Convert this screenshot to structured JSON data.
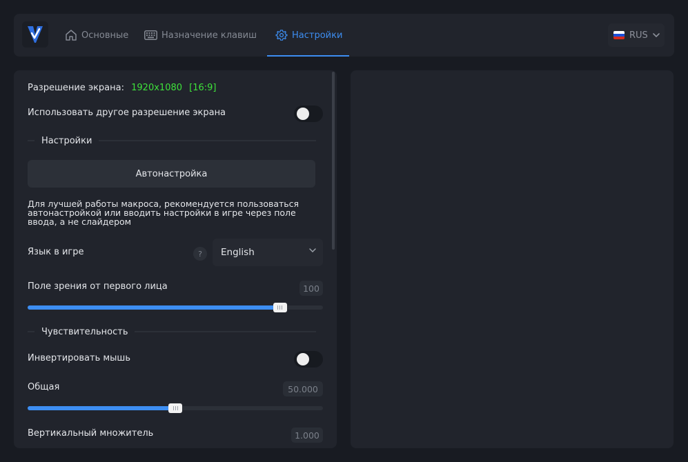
{
  "nav": {
    "tabs": [
      {
        "label": "Основные",
        "icon": "home-icon",
        "active": false
      },
      {
        "label": "Назначение клавиш",
        "icon": "keyboard-icon",
        "active": false
      },
      {
        "label": "Настройки",
        "icon": "gear-icon",
        "active": true
      }
    ],
    "language": {
      "code": "RUS",
      "flag_colors": [
        "#ffffff",
        "#1c4fd8",
        "#d52b1e"
      ]
    }
  },
  "settings": {
    "resolution": {
      "label": "Разрешение экрана:",
      "value": "1920x1080",
      "aspect": "[16:9]"
    },
    "custom_resolution": {
      "label": "Использовать другое разрешение экрана",
      "enabled": false
    },
    "section_settings": "Настройки",
    "autotune_button": "Автонастройка",
    "note": "Для лучшей работы макроса, рекомендуется пользоваться автонастройкой или вводить настройки в игре через поле ввода, а не слайдером",
    "game_language": {
      "label": "Язык в игре",
      "help": "?",
      "selected": "English"
    },
    "fov": {
      "label": "Поле зрения от первого лица",
      "value": "100",
      "fraction": 0.854
    },
    "section_sensitivity": "Чувствительность",
    "invert_mouse": {
      "label": "Инвертировать мышь",
      "enabled": false
    },
    "general": {
      "label": "Общая",
      "value": "50.000",
      "fraction": 0.5
    },
    "vertical_multiplier": {
      "label": "Вертикальный множитель",
      "value": "1.000"
    }
  },
  "colors": {
    "accent": "#3d8ef2",
    "resolution_value": "#3ee23a"
  }
}
